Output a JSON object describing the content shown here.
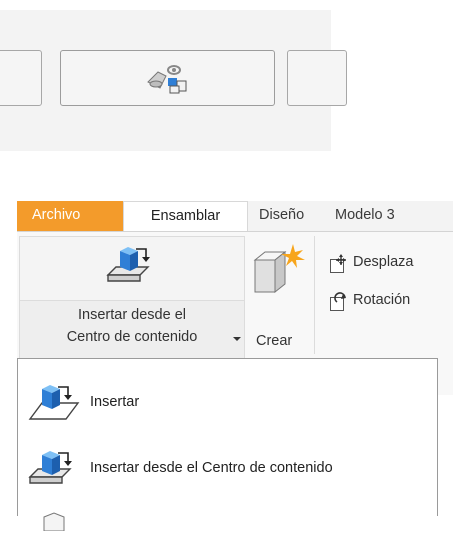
{
  "top_panel": {
    "icon": "rotate-assembly-icon"
  },
  "ribbon": {
    "tabs": [
      {
        "label": "Archivo"
      },
      {
        "label": "Ensamblar"
      },
      {
        "label": "Diseño"
      },
      {
        "label": "Modelo 3"
      }
    ],
    "insert_from_cc_button": {
      "label_line1": "Insertar desde el",
      "label_line2": "Centro de contenido",
      "icon": "insert-from-content-center-icon"
    },
    "crear_button": {
      "label": "Crear",
      "icon": "create-component-icon"
    },
    "small_buttons": [
      {
        "label": "Desplaza",
        "icon": "free-move-icon"
      },
      {
        "label": "Rotación",
        "icon": "free-rotate-icon"
      }
    ],
    "dropdown": {
      "items": [
        {
          "label": "Insertar",
          "icon": "insert-component-icon"
        },
        {
          "label": "Insertar desde el Centro de contenido",
          "icon": "insert-from-content-center-icon"
        },
        {
          "label": "",
          "icon": "component-icon"
        }
      ]
    }
  }
}
